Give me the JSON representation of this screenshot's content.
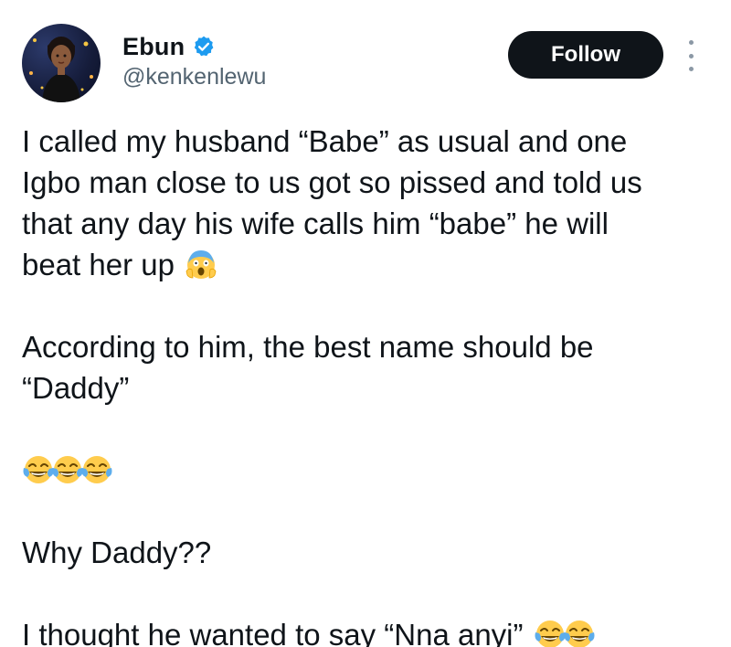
{
  "author": {
    "display_name": "Ebun",
    "handle": "@kenkenlewu",
    "verified": true,
    "avatar_icon": "avatar-woman-icon"
  },
  "actions": {
    "follow_label": "Follow",
    "more_icon": "more-vertical-icon"
  },
  "tweet": {
    "line1": "I called my husband “Babe” as usual and one",
    "line2": "Igbo man close to us got so pissed and told us",
    "line3": "that any day his wife calls him “babe” he will",
    "line4": "beat her up",
    "para2_line1": "According to him, the best name should be",
    "para2_line2": "“Daddy”",
    "para4": "Why Daddy??",
    "para5": "I thought he wanted to say “Nna anyi”"
  },
  "colors": {
    "text": "#0f1419",
    "secondary": "#536471",
    "verified_blue": "#1d9bf0",
    "button_bg": "#0f1419"
  }
}
